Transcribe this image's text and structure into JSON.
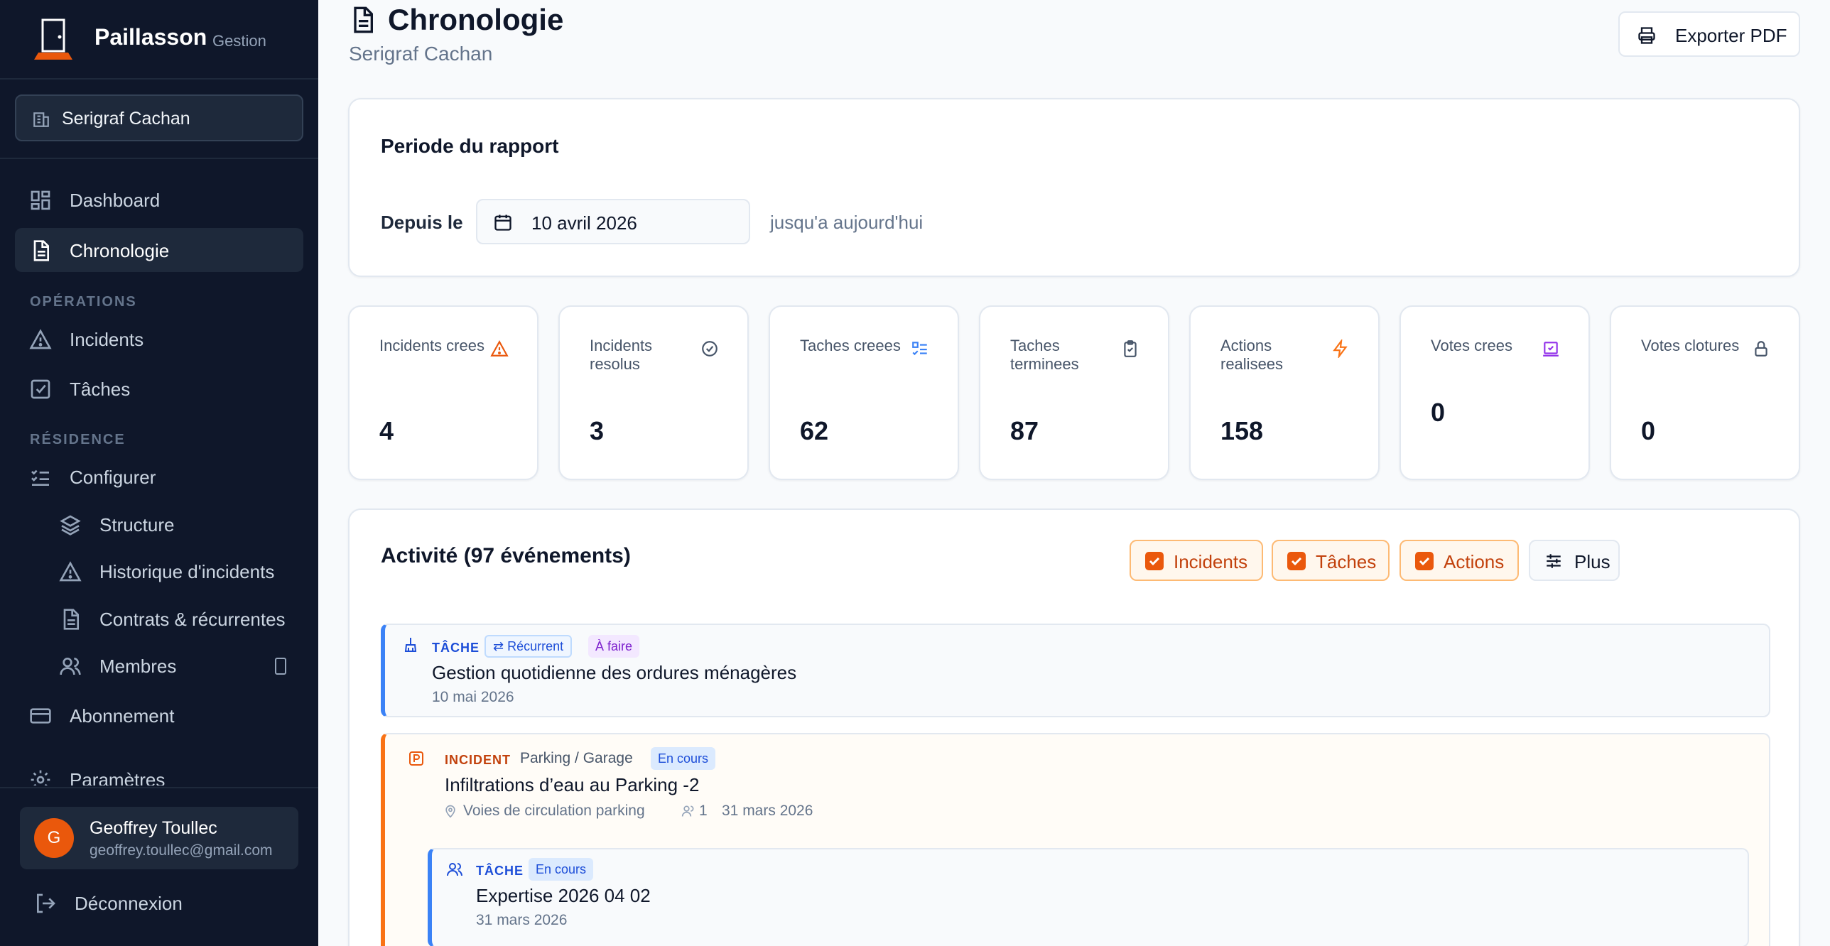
{
  "brand": {
    "name": "Paillasson",
    "subtitle": "Gestion"
  },
  "residence_selector": {
    "label": "Serigraf Cachan"
  },
  "nav": {
    "dashboard": "Dashboard",
    "chronologie": "Chronologie",
    "section_operations": "OPÉRATIONS",
    "incidents": "Incidents",
    "taches": "Tâches",
    "section_residence": "RÉSIDENCE",
    "configurer": "Configurer",
    "structure": "Structure",
    "historique": "Historique d'incidents",
    "contrats": "Contrats & récurrentes",
    "membres": "Membres",
    "abonnement": "Abonnement",
    "parametres": "Paramètres"
  },
  "user": {
    "initial": "G",
    "name": "Geoffrey Toullec",
    "email": "geoffrey.toullec@gmail.com"
  },
  "logout_label": "Déconnexion",
  "header": {
    "title": "Chronologie",
    "subtitle": "Serigraf Cachan",
    "export_label": "Exporter PDF"
  },
  "period": {
    "title": "Periode du rapport",
    "since_label": "Depuis le",
    "date_value": "10 avril 2026",
    "until_label": "jusqu'a aujourd'hui"
  },
  "stats": [
    {
      "label": "Incidents crees",
      "value": "4",
      "icon": "warning-icon"
    },
    {
      "label": "Incidents resolus",
      "value": "3",
      "icon": "check-circle-icon"
    },
    {
      "label": "Taches creees",
      "value": "62",
      "icon": "list-checks-icon"
    },
    {
      "label": "Taches terminees",
      "value": "87",
      "icon": "clipboard-check-icon"
    },
    {
      "label": "Actions realisees",
      "value": "158",
      "icon": "bolt-icon"
    },
    {
      "label": "Votes crees",
      "value": "0",
      "icon": "vote-icon"
    },
    {
      "label": "Votes clotures",
      "value": "0",
      "icon": "lock-icon"
    }
  ],
  "activity": {
    "title": "Activité (97 événements)",
    "filters": {
      "incidents": "Incidents",
      "taches": "Tâches",
      "actions": "Actions",
      "plus": "Plus"
    },
    "events": [
      {
        "type": "TÂCHE",
        "recurring": "Récurrent",
        "status": "À faire",
        "title": "Gestion quotidienne des ordures ménagères",
        "date": "10 mai 2026"
      },
      {
        "type": "INCIDENT",
        "category": "Parking / Garage",
        "status": "En cours",
        "title": "Infiltrations d’eau au Parking -2",
        "location": "Voies de circulation parking",
        "people": "1",
        "date": "31 mars 2026"
      },
      {
        "type": "TÂCHE",
        "status": "En cours",
        "title": "Expertise 2026 04 02",
        "date": "31 mars 2026"
      }
    ]
  },
  "colors": {
    "sidebar_bg": "#0f172a",
    "accent": "#ea580c",
    "task_accent": "#3b82f6"
  }
}
